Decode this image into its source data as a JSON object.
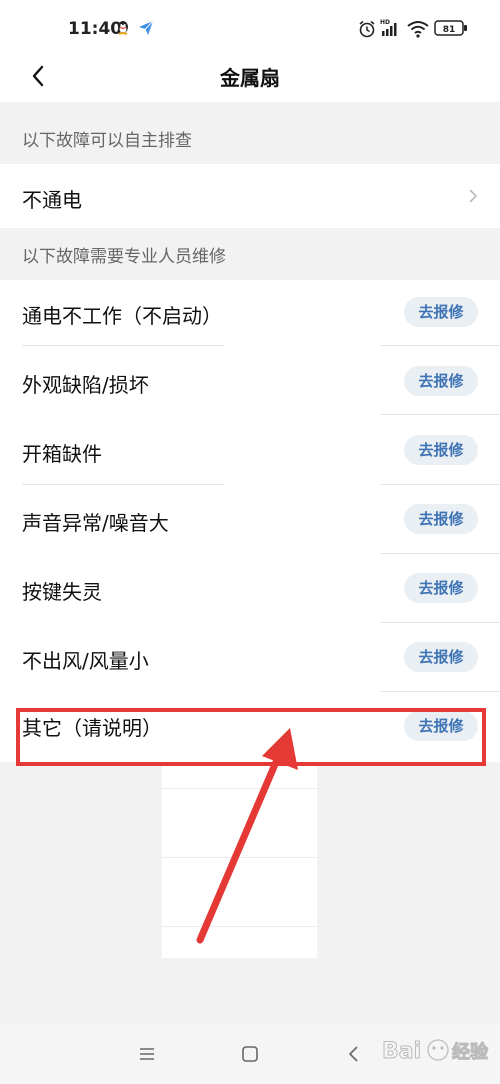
{
  "status_bar": {
    "time": "11:40",
    "icons": [
      "qq-icon",
      "paper-plane-icon",
      "alarm-icon",
      "signal-hd-icon",
      "wifi-icon",
      "battery-icon"
    ],
    "battery": "81"
  },
  "nav": {
    "title": "金属扇",
    "back_icon": "back-chevron-icon"
  },
  "self_check": {
    "header": "以下故障可以自主排查",
    "items": [
      {
        "label": "不通电"
      }
    ]
  },
  "professional": {
    "header": "以下故障需要专业人员维修",
    "button_label": "去报修",
    "items": [
      {
        "label": "通电不工作（不启动）"
      },
      {
        "label": "外观缺陷/损坏"
      },
      {
        "label": "开箱缺件"
      },
      {
        "label": "声音异常/噪音大"
      },
      {
        "label": "按键失灵"
      },
      {
        "label": "不出风/风量小"
      },
      {
        "label": "其它（请说明）"
      }
    ]
  },
  "bottom_nav": {
    "icons": [
      "menu-icon",
      "home-square-icon",
      "back-icon"
    ]
  },
  "watermark": {
    "text_left": "Bai",
    "text_right": "经验"
  },
  "annotation": {
    "color": "#e53935"
  },
  "colors": {
    "button_bg": "#eaeff4",
    "button_text": "#3f74b5",
    "page_bg": "#f2f2f2"
  }
}
